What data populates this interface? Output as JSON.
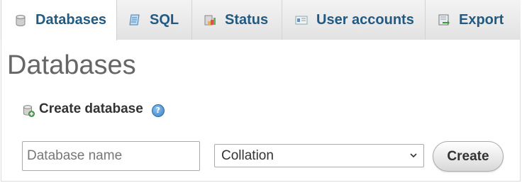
{
  "tabs": [
    {
      "label": "Databases",
      "icon": "database-icon",
      "active": true
    },
    {
      "label": "SQL",
      "icon": "sql-icon",
      "active": false
    },
    {
      "label": "Status",
      "icon": "status-icon",
      "active": false
    },
    {
      "label": "User accounts",
      "icon": "user-accounts-icon",
      "active": false
    },
    {
      "label": "Export",
      "icon": "export-icon",
      "active": false
    }
  ],
  "page": {
    "title": "Databases"
  },
  "create_db": {
    "heading": "Create database",
    "help_glyph": "?",
    "name_placeholder": "Database name",
    "name_value": "",
    "collation_selected": "Collation",
    "create_label": "Create"
  },
  "colors": {
    "tab_text": "#235a81",
    "tab_bg": "#e7e7e7",
    "title_text": "#666666",
    "help_blue": "#3a7fc4"
  }
}
